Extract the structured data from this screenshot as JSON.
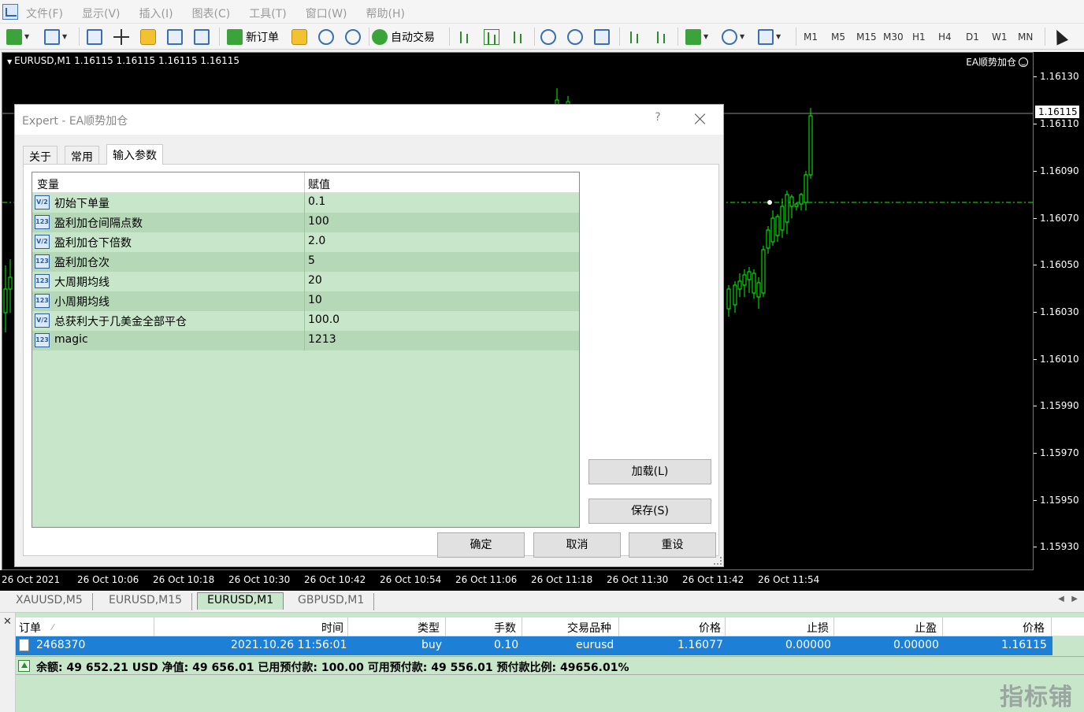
{
  "menu": [
    "文件(F)",
    "显示(V)",
    "插入(I)",
    "图表(C)",
    "工具(T)",
    "窗口(W)",
    "帮助(H)"
  ],
  "toolbar": {
    "new_order": "新订单",
    "auto_trading": "自动交易",
    "timeframes": [
      "M1",
      "M5",
      "M15",
      "M30",
      "H1",
      "H4",
      "D1",
      "W1",
      "MN"
    ]
  },
  "chart": {
    "header": "EURUSD,M1  1.16115 1.16115 1.16115 1.16115",
    "ea_label": "EA顺势加仓",
    "current_price": "1.16115",
    "price_labels": [
      "1.16130",
      "1.16110",
      "1.16090",
      "1.16070",
      "1.16050",
      "1.16030",
      "1.16010",
      "1.15990",
      "1.15970",
      "1.15950",
      "1.15930"
    ],
    "time_labels": [
      "26 Oct 2021",
      "26 Oct 10:06",
      "26 Oct 10:18",
      "26 Oct 10:30",
      "26 Oct 10:42",
      "26 Oct 10:54",
      "26 Oct 11:06",
      "26 Oct 11:18",
      "26 Oct 11:30",
      "26 Oct 11:42",
      "26 Oct 11:54"
    ],
    "colors": {
      "bull": "#00ff00",
      "bear": "#ffffff",
      "bg": "#000000"
    }
  },
  "chart_tabs": [
    "XAUUSD,M5",
    "EURUSD,M15",
    "EURUSD,M1",
    "GBPUSD,M1"
  ],
  "dialog": {
    "title": "Expert - EA顺势加仓",
    "help": "?",
    "tabs": [
      "关于",
      "常用",
      "输入参数"
    ],
    "columns": {
      "variable": "变量",
      "value": "赋值"
    },
    "params": [
      {
        "icon": "V/2",
        "name": "初始下单量",
        "value": "0.1"
      },
      {
        "icon": "123",
        "name": "盈利加仓间隔点数",
        "value": "100"
      },
      {
        "icon": "V/2",
        "name": "盈利加仓下倍数",
        "value": "2.0"
      },
      {
        "icon": "123",
        "name": "盈利加仓次",
        "value": "5"
      },
      {
        "icon": "123",
        "name": "大周期均线",
        "value": "20"
      },
      {
        "icon": "123",
        "name": "小周期均线",
        "value": "10"
      },
      {
        "icon": "V/2",
        "name": "总获利大于几美金全部平仓",
        "value": "100.0"
      },
      {
        "icon": "123",
        "name": "magic",
        "value": "1213"
      }
    ],
    "buttons": {
      "load": "加载(L)",
      "save": "保存(S)",
      "ok": "确定",
      "cancel": "取消",
      "reset": "重设"
    }
  },
  "terminal": {
    "close": "✕",
    "headers": [
      "订单",
      "时间",
      "类型",
      "手数",
      "交易品种",
      "价格",
      "止损",
      "止盈",
      "价格"
    ],
    "sort_mark": "⁄",
    "order": {
      "id": "2468370",
      "time": "2021.10.26 11:56:01",
      "type": "buy",
      "lots": "0.10",
      "symbol": "eurusd",
      "price": "1.16077",
      "sl": "0.00000",
      "tp": "0.00000",
      "cur_price": "1.16115"
    },
    "summary": "余额: 49 652.21 USD  净值: 49 656.01  已用预付款: 100.00  可用预付款: 49 556.01  预付款比例: 49656.01%"
  },
  "watermark": "指标铺"
}
